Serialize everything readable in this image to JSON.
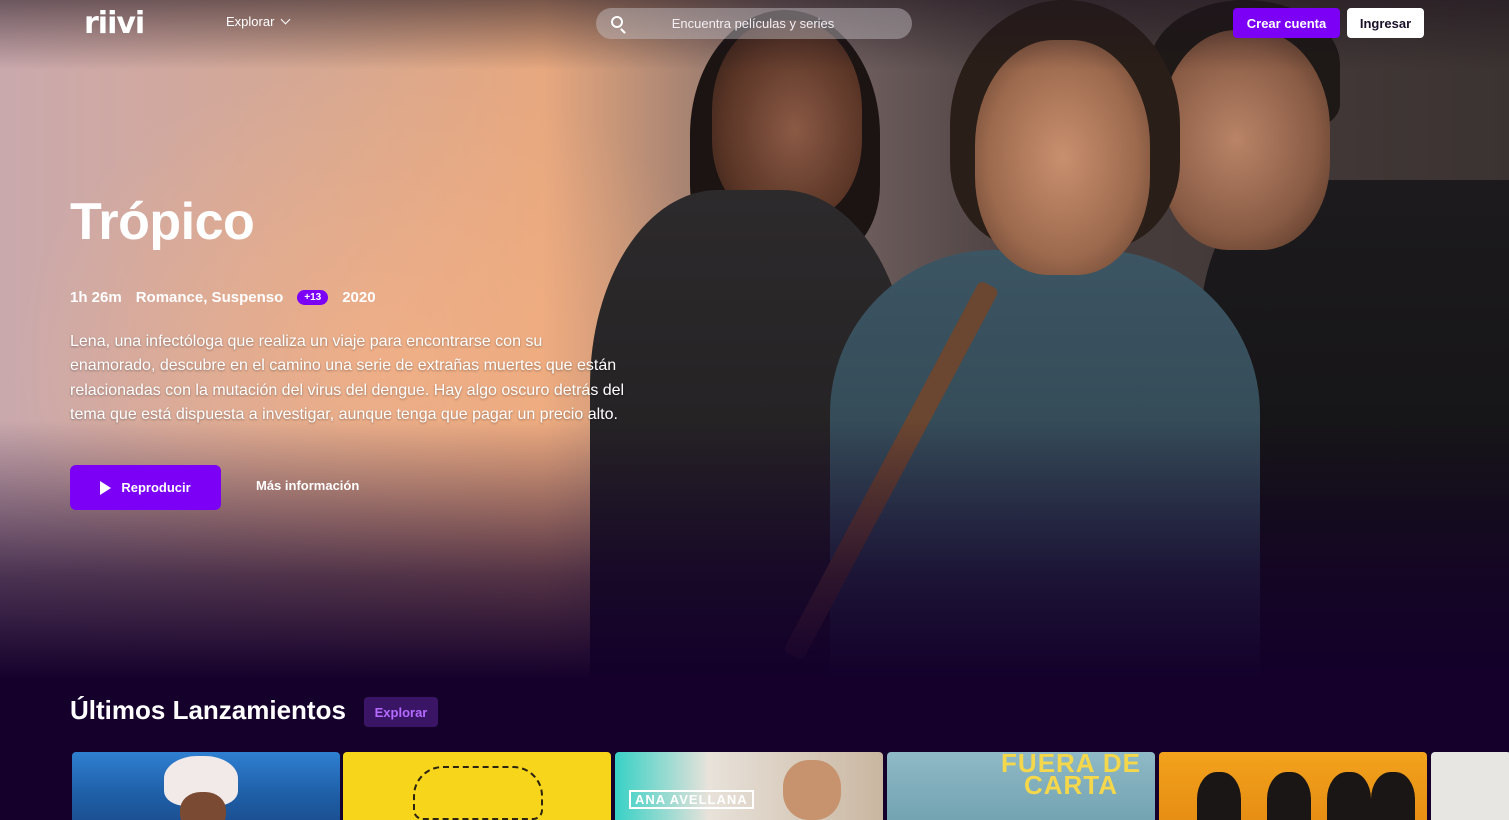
{
  "nav": {
    "logo": "riivi",
    "explore_label": "Explorar",
    "search_placeholder": "Encuentra películas y series",
    "create_account_label": "Crear cuenta",
    "login_label": "Ingresar"
  },
  "hero": {
    "title": "Trópico",
    "duration": "1h 26m",
    "genres": "Romance, Suspenso",
    "rating": "+13",
    "year": "2020",
    "synopsis": "Lena, una infectóloga que realiza un viaje para encontrarse con su enamorado, descubre en el camino una serie de extrañas muertes que están relacionadas con la mutación del virus del dengue. Hay algo oscuro detrás del tema que está dispuesta a investigar, aunque tenga que pagar un precio alto.",
    "play_label": "Reproducir",
    "more_info_label": "Más información"
  },
  "section": {
    "title": "Últimos Lanzamientos",
    "explore_label": "Explorar",
    "cards": [
      {
        "label": ""
      },
      {
        "label": ""
      },
      {
        "label": "ANA AVELLANA"
      },
      {
        "label": "FUERA DE CARTA"
      },
      {
        "label": ""
      },
      {
        "label": ""
      }
    ]
  },
  "colors": {
    "accent": "#7b00f5",
    "background": "#14002b"
  }
}
